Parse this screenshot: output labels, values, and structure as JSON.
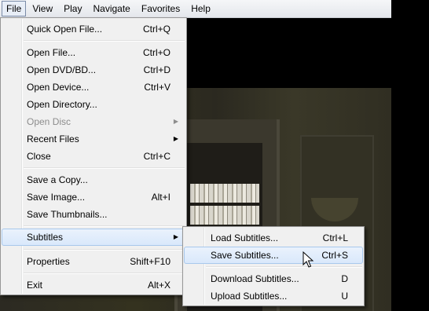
{
  "menubar": {
    "items": [
      {
        "label": "File",
        "active": true
      },
      {
        "label": "View"
      },
      {
        "label": "Play"
      },
      {
        "label": "Navigate"
      },
      {
        "label": "Favorites"
      },
      {
        "label": "Help"
      }
    ]
  },
  "file_menu": {
    "quick_open": {
      "label": "Quick Open File...",
      "shortcut": "Ctrl+Q"
    },
    "open_file": {
      "label": "Open File...",
      "shortcut": "Ctrl+O"
    },
    "open_dvd": {
      "label": "Open DVD/BD...",
      "shortcut": "Ctrl+D"
    },
    "open_device": {
      "label": "Open Device...",
      "shortcut": "Ctrl+V"
    },
    "open_directory": {
      "label": "Open Directory...",
      "shortcut": ""
    },
    "open_disc": {
      "label": "Open Disc",
      "shortcut": ""
    },
    "recent_files": {
      "label": "Recent Files",
      "shortcut": ""
    },
    "close": {
      "label": "Close",
      "shortcut": "Ctrl+C"
    },
    "save_copy": {
      "label": "Save a Copy...",
      "shortcut": ""
    },
    "save_image": {
      "label": "Save Image...",
      "shortcut": "Alt+I"
    },
    "save_thumbnails": {
      "label": "Save Thumbnails...",
      "shortcut": ""
    },
    "subtitles": {
      "label": "Subtitles",
      "shortcut": ""
    },
    "properties": {
      "label": "Properties",
      "shortcut": "Shift+F10"
    },
    "exit": {
      "label": "Exit",
      "shortcut": "Alt+X"
    }
  },
  "subtitles_menu": {
    "load": {
      "label": "Load Subtitles...",
      "shortcut": "Ctrl+L"
    },
    "save": {
      "label": "Save Subtitles...",
      "shortcut": "Ctrl+S"
    },
    "download": {
      "label": "Download Subtitles...",
      "shortcut": "D"
    },
    "upload": {
      "label": "Upload Subtitles...",
      "shortcut": "U"
    }
  }
}
